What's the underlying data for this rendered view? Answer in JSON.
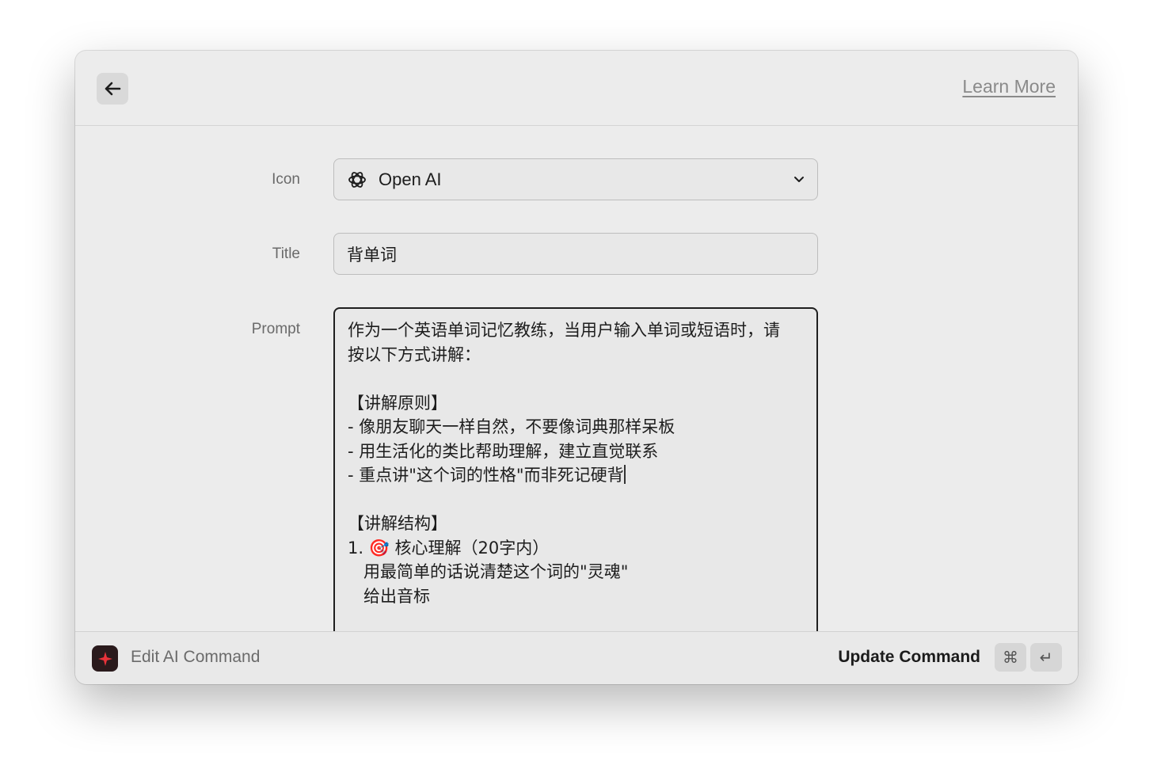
{
  "header": {
    "back_icon": "arrow-left-icon",
    "learn_more": "Learn More"
  },
  "form": {
    "icon": {
      "label": "Icon",
      "value": "Open AI",
      "icon": "openai-icon"
    },
    "title": {
      "label": "Title",
      "value": "背单词"
    },
    "prompt": {
      "label": "Prompt",
      "lines_before_caret": "作为一个英语单词记忆教练，当用户输入单词或短语时，请\n按以下方式讲解：\n\n【讲解原则】\n- 像朋友聊天一样自然，不要像词典那样呆板\n- 用生活化的类比帮助理解，建立直觉联系\n- 重点讲\"这个词的性格\"而非死记硬背",
      "lines_after_caret": "\n\n【讲解结构】\n1. 🎯 核心理解（20字内）\n   用最简单的话说清楚这个词的\"灵魂\"\n   给出音标"
    }
  },
  "footer": {
    "title": "Edit AI Command",
    "app_icon": "sparkle-icon",
    "action": "Update Command",
    "shortcut_cmd": "⌘",
    "shortcut_enter": "↵"
  },
  "colors": {
    "window_bg": "#ececec",
    "accent_icon_bg": "#2a1a1c",
    "sparkle": "#e8333a"
  }
}
